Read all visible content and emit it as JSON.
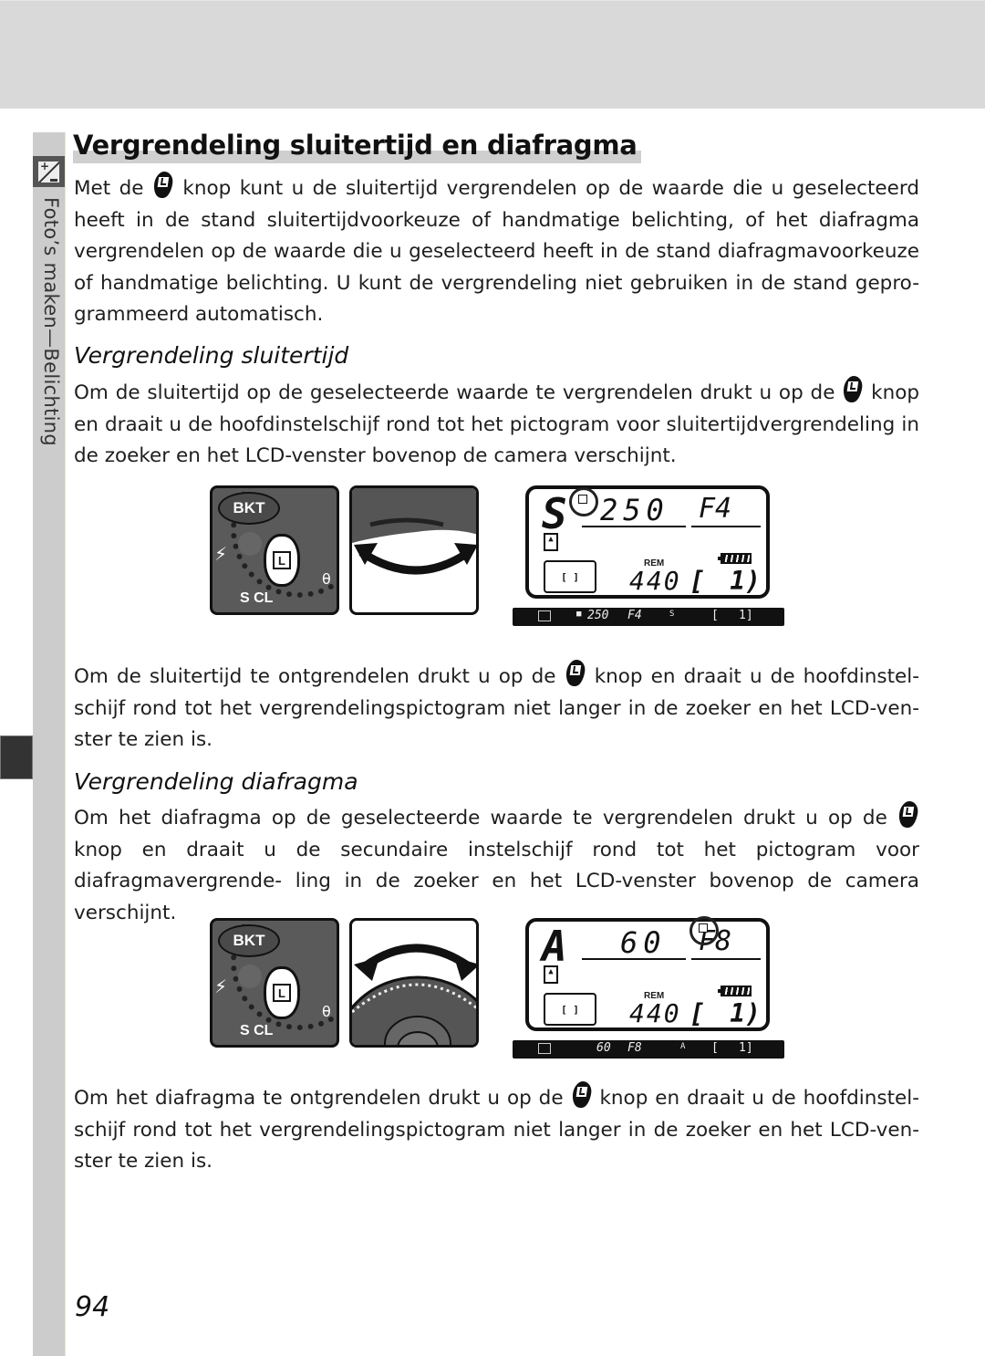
{
  "page": {
    "side_tab_label": "Foto’s maken—Belichting",
    "page_number": "94",
    "colors": {
      "top_band": "#d9d9d9",
      "side_strip": "#cccccc",
      "side_icon_bg": "#555555",
      "side_tab": "#333333"
    }
  },
  "section": {
    "title": "Vergrendeling sluitertijd en diafragma",
    "intro": {
      "before_icon": "Met de",
      "icon": "L-lock-button-icon",
      "after_icon": "knop kunt u de sluitertijd vergrendelen op de waarde die u geselecteerd heeft in de stand sluitertijdvoorkeuze of handmatige belichting, of het diafragma vergrendelen op de waarde die u geselecteerd heeft in de stand diafragmavoorkeuze of handmatige belichting. U kunt de vergrendeling niet gebruiken in de stand gepro- grammeerd automatisch."
    }
  },
  "shutter_lock": {
    "heading": "Vergrendeling sluitertijd",
    "lock_text_before": "Om de sluitertijd op de geselecteerde waarde te vergrendelen drukt u op de",
    "lock_text_after": "knop en draait u de hoofdinstelschijf rond tot het pictogram voor sluitertijdvergrendeling in de zoeker en het LCD-venster bovenop de camera verschijnt.",
    "unlock_text_before": "Om de sluitertijd te ontgrendelen drukt u op de",
    "unlock_text_after": "knop en draait u de hoofdinstel- schijf rond tot het vergrendelingspictogram niet langer in de zoeker en het LCD-ven- ster te zien is.",
    "figure": {
      "button_label": "BKT",
      "lock_key": "L",
      "dial_labels": "S CL",
      "lcd": {
        "mode": "S",
        "shutter": "250",
        "aperture": "F4",
        "rem_label": "REM",
        "count": "440",
        "frames_open": "[",
        "frames": "1)",
        "af_area": "[ ]"
      },
      "viewfinder": {
        "shutter": "250",
        "aperture": "F4",
        "mode": "S",
        "bracket": "[",
        "frames": "1]"
      }
    }
  },
  "aperture_lock": {
    "heading": "Vergrendeling diafragma",
    "lock_text_before": "Om het diafragma op de geselecteerde waarde te vergrendelen drukt u op de",
    "lock_text_after": "knop en draait u de secundaire instelschijf rond tot het pictogram voor diafragmavergrende- ling in de zoeker en het LCD-venster bovenop de camera verschijnt.",
    "unlock_text_before": "Om het diafragma te ontgrendelen drukt u op de",
    "unlock_text_after": "knop en draait u de hoofdinstel- schijf rond tot het vergrendelingspictogram niet langer in de zoeker en het LCD-ven- ster te zien is.",
    "figure": {
      "button_label": "BKT",
      "lock_key": "L",
      "dial_labels": "S CL",
      "lcd": {
        "mode": "A",
        "shutter": "60",
        "aperture": "F8",
        "rem_label": "REM",
        "count": "440",
        "frames_open": "[",
        "frames": "1)",
        "af_area": "[ ]"
      },
      "viewfinder": {
        "shutter": "60",
        "aperture": "F8",
        "mode": "A",
        "bracket": "[",
        "frames": "1]"
      }
    }
  }
}
